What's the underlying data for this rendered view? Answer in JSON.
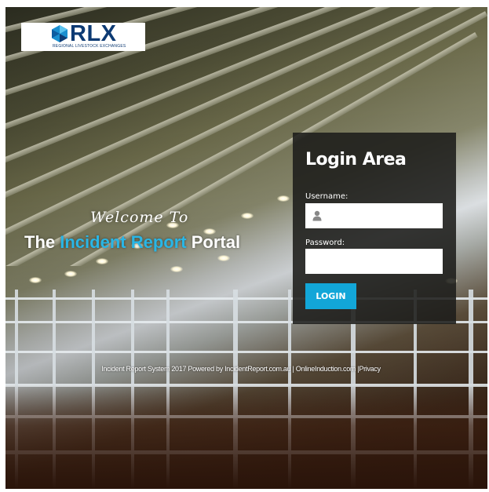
{
  "logo": {
    "brand": "RLX",
    "tagline": "REGIONAL LIVESTOCK EXCHANGES",
    "brand_color": "#0d3a73"
  },
  "hero": {
    "welcome": "Welcome To",
    "title_prefix": "The",
    "title_highlight": "Incident Report",
    "title_suffix": "Portal",
    "highlight_color": "#29b6e6"
  },
  "login": {
    "title": "Login Area",
    "username_label": "Username:",
    "username_value": "",
    "password_label": "Password:",
    "password_value": "",
    "button_label": "LOGIN",
    "button_color": "#12a6d8"
  },
  "footer": {
    "text": "Incident Report System 2017 Powered by IncidentReport.com.au | OnlineInduction.com |Privacy"
  }
}
